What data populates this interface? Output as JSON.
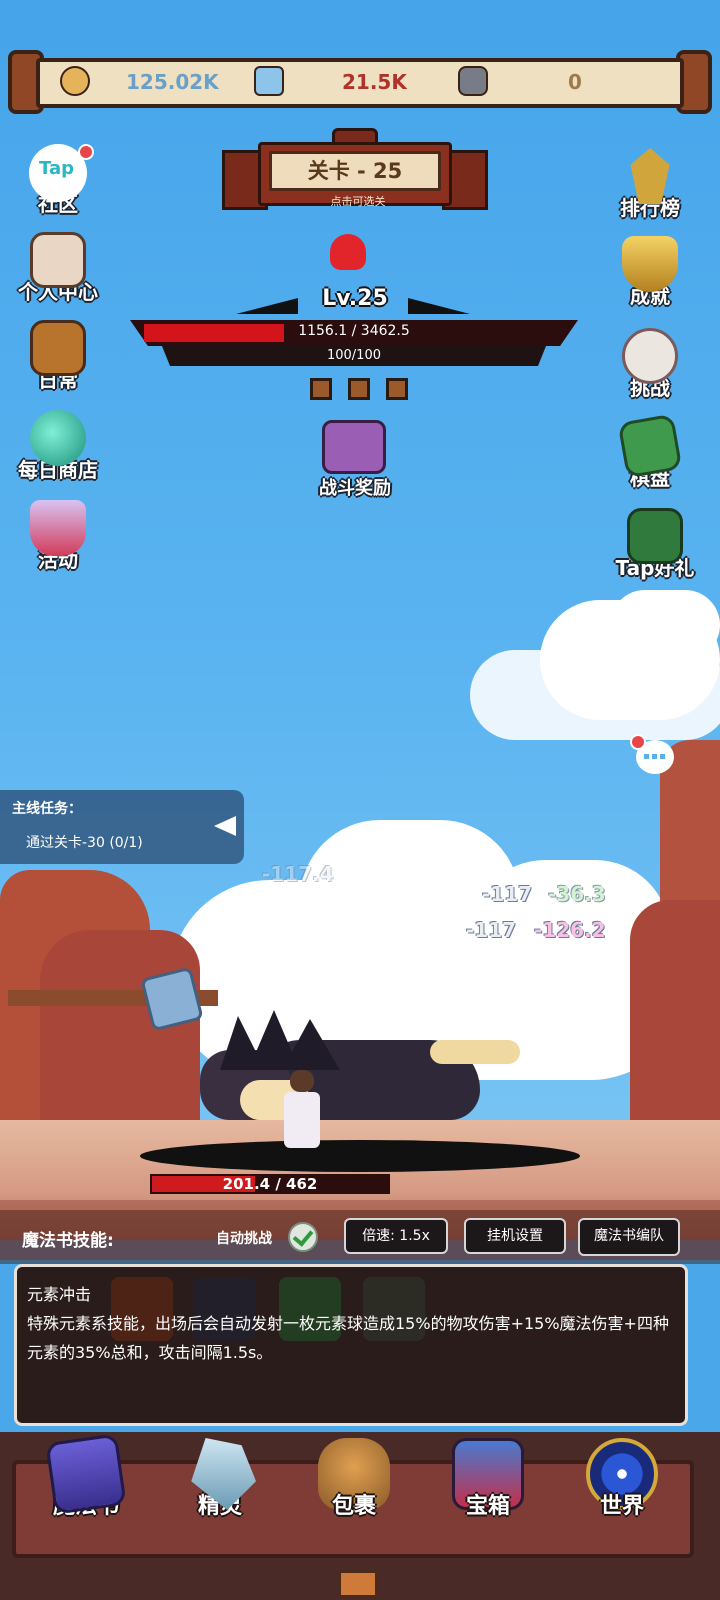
{
  "resources": {
    "gold": "125.02K",
    "gem": "21.5K",
    "rune": "0"
  },
  "stage": {
    "title": "关卡 - 25",
    "subtitle": "点击可选关"
  },
  "left_menu": [
    {
      "label": "社区",
      "icon": "tap-icon"
    },
    {
      "label": "个人中心",
      "icon": "letter-icon"
    },
    {
      "label": "日常",
      "icon": "barrel-icon"
    },
    {
      "label": "每日商店",
      "icon": "orb-icon"
    },
    {
      "label": "活动",
      "icon": "cup-icon"
    }
  ],
  "tap_logo": "Tap",
  "right_menu": [
    {
      "label": "排行榜",
      "icon": "trophy-sword-icon"
    },
    {
      "label": "成就",
      "icon": "gold-cup-icon"
    },
    {
      "label": "挑战",
      "icon": "skull-icon"
    },
    {
      "label": "棋盘",
      "icon": "board-icon"
    },
    {
      "label": "Tap好礼",
      "icon": "gift-chest-icon"
    }
  ],
  "boss": {
    "level": "Lv.25",
    "hp_text": "1156.1 / 3462.5",
    "hp_fraction": 0.334,
    "mp_text": "100/100",
    "reward_label": "战斗奖励"
  },
  "quest": {
    "title": "主线任务：",
    "desc": "通过关卡-30  (0/1)"
  },
  "damage_numbers": [
    "-117.4",
    "-117",
    "-36.3",
    "-117",
    "-126.2"
  ],
  "player": {
    "hp_text": "201.4 / 462",
    "hp_fraction": 0.436
  },
  "controls": {
    "skills_label": "魔法书技能:",
    "auto_label": "自动挑战",
    "speed_label": "倍速: 1.5x",
    "idle_label": "挂机设置",
    "team_label": "魔法书编队"
  },
  "skill": {
    "name": "元素冲击",
    "description": "特殊元素系技能，出场后会自动发射一枚元素球造成15%的物攻伤害+15%魔法伤害+四种元素的35%总和，攻击间隔1.5s。"
  },
  "bottom_nav": [
    {
      "label": "魔法书",
      "icon": "spellbook-icon"
    },
    {
      "label": "精灵",
      "icon": "crystal-icon"
    },
    {
      "label": "包裹",
      "icon": "bag-icon"
    },
    {
      "label": "宝箱",
      "icon": "treasure-chest-icon"
    },
    {
      "label": "世界",
      "icon": "eye-orb-icon"
    }
  ],
  "colors": {
    "sky": "#49a7ea",
    "hp_red": "#d3141a",
    "gold_text": "#6aa0c8",
    "gem_text": "#b0332a",
    "rune_text": "#a07a4a"
  }
}
